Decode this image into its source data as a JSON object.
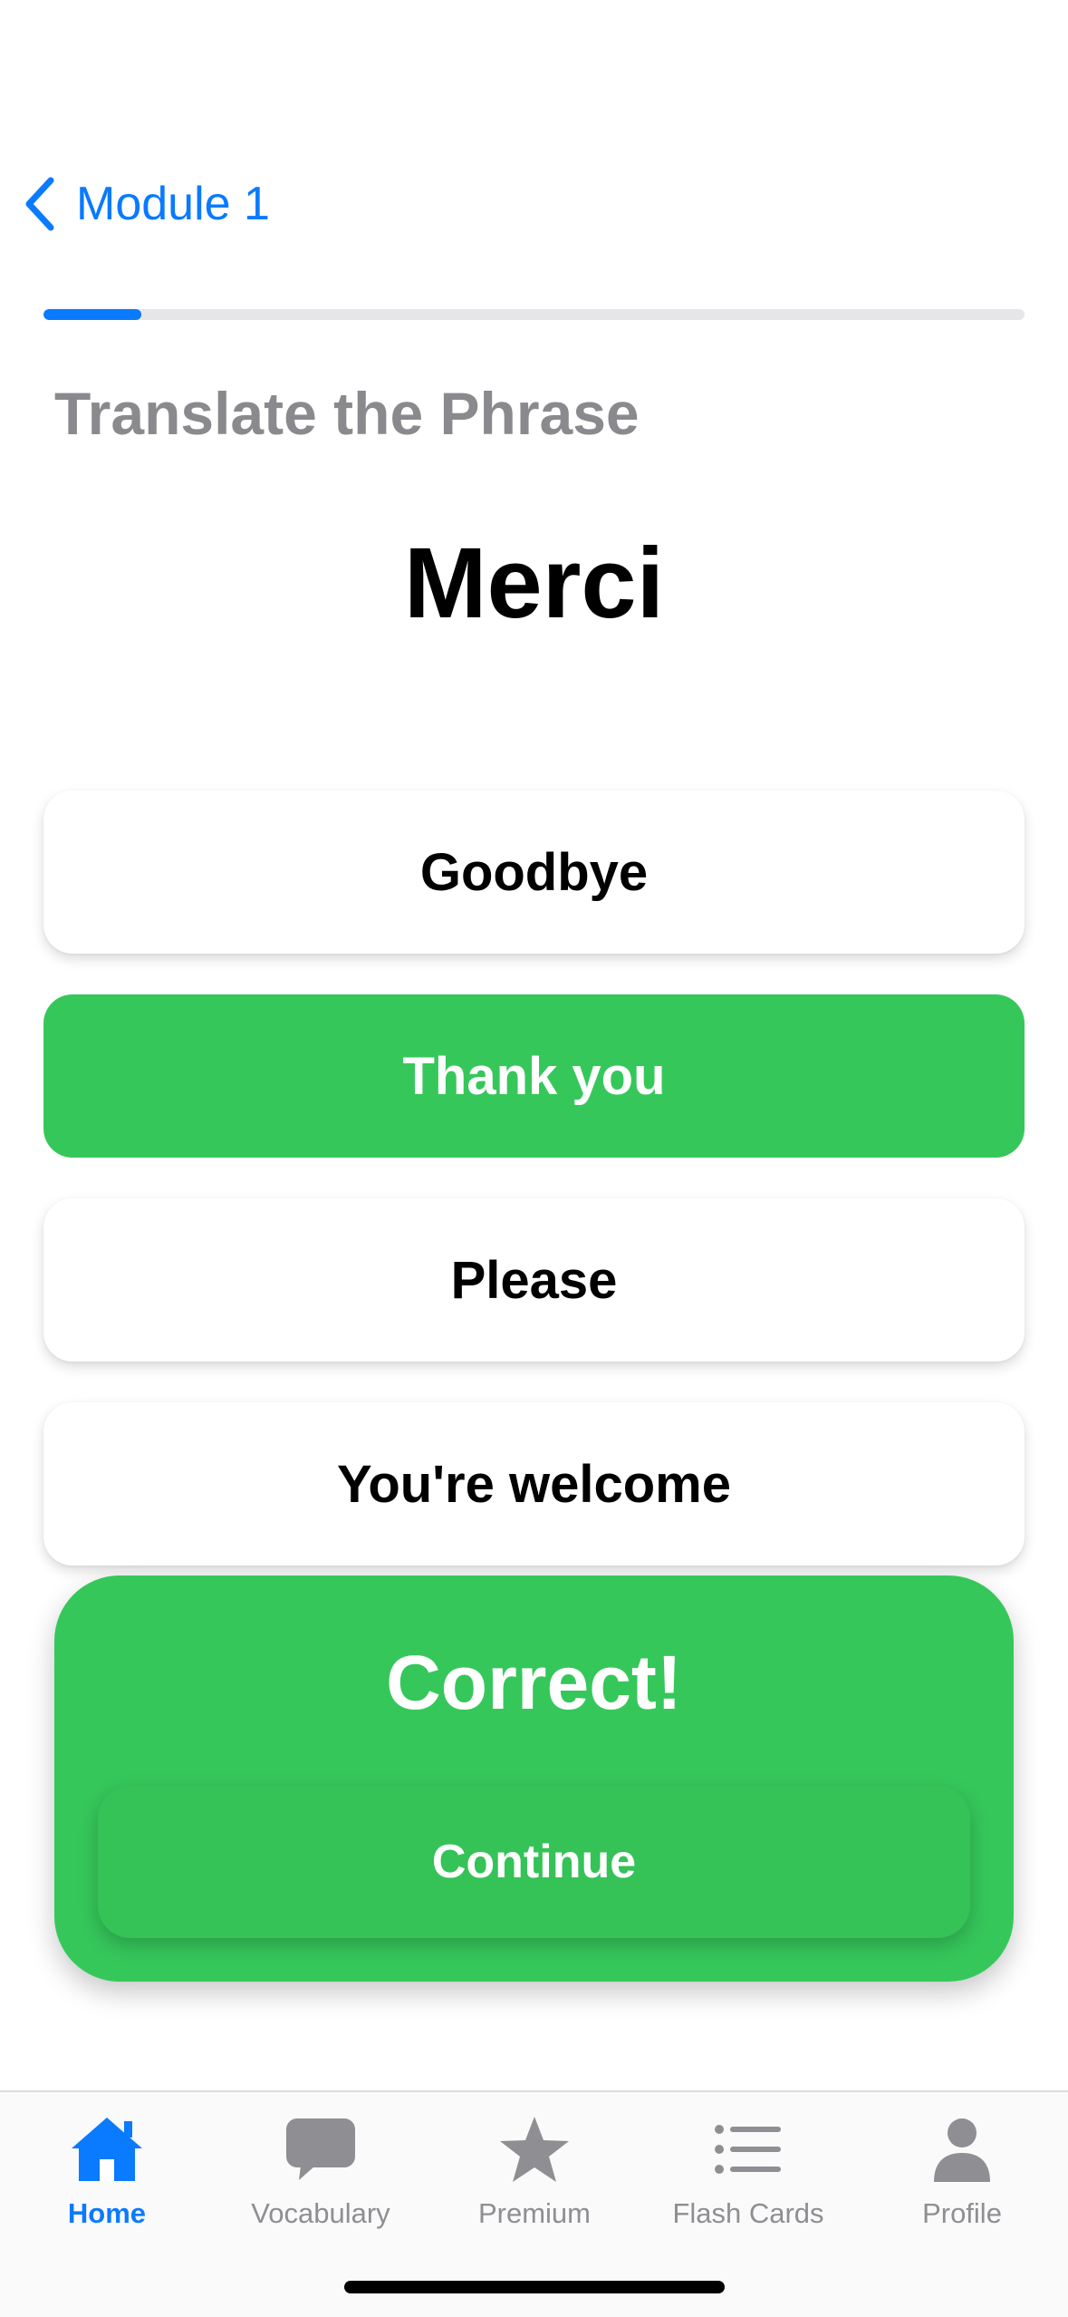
{
  "nav": {
    "back_label": "Module 1"
  },
  "progress": {
    "fraction": 0.1
  },
  "prompt": {
    "title": "Translate the Phrase",
    "phrase": "Merci"
  },
  "options": [
    {
      "label": "Goodbye",
      "state": "default"
    },
    {
      "label": "Thank you",
      "state": "correct"
    },
    {
      "label": "Please",
      "state": "default"
    },
    {
      "label": "You're welcome",
      "state": "default"
    }
  ],
  "result": {
    "title": "Correct!",
    "continue_label": "Continue"
  },
  "tabs": [
    {
      "label": "Home",
      "icon": "house-icon",
      "active": true
    },
    {
      "label": "Vocabulary",
      "icon": "chat-bubble-icon",
      "active": false
    },
    {
      "label": "Premium",
      "icon": "star-icon",
      "active": false
    },
    {
      "label": "Flash Cards",
      "icon": "list-icon",
      "active": false
    },
    {
      "label": "Profile",
      "icon": "person-icon",
      "active": false
    }
  ],
  "colors": {
    "accent": "#0a7aff",
    "success": "#36c75b",
    "muted": "#8e8e93"
  }
}
